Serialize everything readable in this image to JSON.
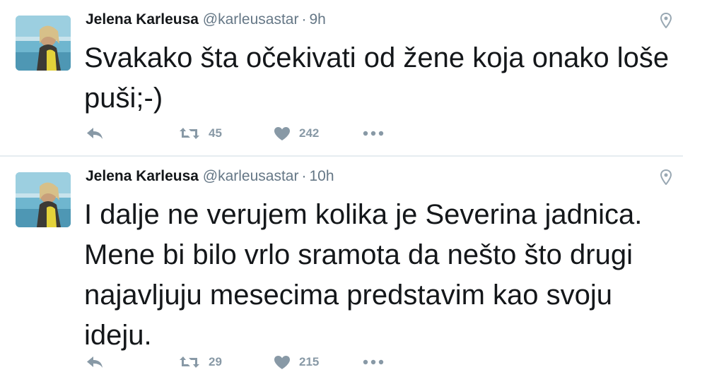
{
  "tweets": [
    {
      "author_name": "Jelena Karleusa",
      "handle": "@karleusastar",
      "separator": "·",
      "time": "9h",
      "text": "Svakako šta očekivati od žene koja onako loše puši;-)",
      "retweets": "45",
      "likes": "242",
      "icons": [
        "avatar-photo",
        "location-pin-icon",
        "reply-icon",
        "retweet-icon",
        "heart-icon",
        "more-dots-icon"
      ]
    },
    {
      "author_name": "Jelena Karleusa",
      "handle": "@karleusastar",
      "separator": "·",
      "time": "10h",
      "text": "I dalje ne verujem kolika je Severina jadnica. Mene bi bilo vrlo sramota da nešto što drugi najavljuju mesecima predstavim kao svoju ideju.",
      "retweets": "29",
      "likes": "215",
      "icons": [
        "avatar-photo",
        "location-pin-icon",
        "reply-icon",
        "retweet-icon",
        "heart-icon",
        "more-dots-icon"
      ]
    }
  ],
  "colors": {
    "text": "#14171a",
    "secondary": "#657786",
    "action": "#8899a6",
    "divider": "#e6ecf0"
  }
}
